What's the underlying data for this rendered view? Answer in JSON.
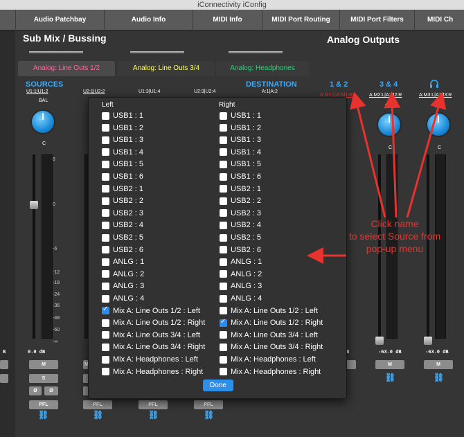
{
  "window": {
    "title": "iConnectivity iConfig"
  },
  "tabs": [
    "Audio Patchbay",
    "Audio Info",
    "MIDI Info",
    "MIDI Port Routing",
    "MIDI Port Filters",
    "MIDI Ch"
  ],
  "left_panel": {
    "title": "Sub Mix / Bussing",
    "sub_tabs": [
      "Analog: Line Outs 1/2",
      "Analog: Line Outs 3/4",
      "Analog: Headphones"
    ],
    "sources_label": "SOURCES",
    "destination_label": "DESTINATION",
    "destination_channel": "A:1|A:2",
    "channel_labels": [
      "U1:1|U1:2",
      "U2:1|U2:2",
      "U1:3|U1:4",
      "U2:3|U2:4"
    ],
    "bal_label": "BAL",
    "center_label": "C",
    "scale": [
      "6",
      "0",
      "-6",
      "-12",
      "-18",
      "-24",
      "-36",
      "-48",
      "-60",
      "-∞"
    ],
    "db_readout": "0.0 dB",
    "left_edge_readout": "B",
    "buttons": {
      "mute": "M",
      "solo": "S",
      "phase": "Ø",
      "pfl": "PFL"
    },
    "link_icon": "link-icon"
  },
  "right_panel": {
    "title": "Analog Outputs",
    "outputs": [
      {
        "label": "1 & 2",
        "source": "A:M1:L|A:M1:R",
        "readout": ""
      },
      {
        "label": "3 & 4",
        "source": "A:M2:L|A:M2:R",
        "readout": "-63.0 dB"
      },
      {
        "label": "headphones-icon",
        "source": "A:M3:L|A:M3:R",
        "readout": "-63.0 dB"
      }
    ],
    "left_edge_readout": "B",
    "bal_label": "BAL",
    "center_label": "C",
    "mute_label": "M"
  },
  "popup": {
    "left_header": "Left",
    "right_header": "Right",
    "options": [
      "USB1 : 1",
      "USB1 : 2",
      "USB1 : 3",
      "USB1 : 4",
      "USB1 : 5",
      "USB1 : 6",
      "USB2 : 1",
      "USB2 : 2",
      "USB2 : 3",
      "USB2 : 4",
      "USB2 : 5",
      "USB2 : 6",
      "ANLG : 1",
      "ANLG : 2",
      "ANLG : 3",
      "ANLG : 4",
      "Mix A: Line Outs 1/2 : Left",
      "Mix A: Line Outs 1/2 : Right",
      "Mix A: Line Outs 3/4 : Left",
      "Mix A: Line Outs 3/4 : Right",
      "Mix A: Headphones : Left",
      "Mix A: Headphones : Right"
    ],
    "left_checked": "Mix A: Line Outs 1/2 : Left",
    "right_checked": "Mix A: Line Outs 1/2 : Right",
    "done_label": "Done"
  },
  "annotation": {
    "lines": [
      "Click name",
      "to select Source from",
      "pop-up menu"
    ],
    "color": "#e8322d"
  },
  "colors": {
    "accent": "#3fa9f5",
    "tab_active_1": "#ff6aa0",
    "tab_active_2": "#ffff66",
    "tab_active_3": "#33d17a",
    "checkbox_on": "#2a8cf0"
  }
}
